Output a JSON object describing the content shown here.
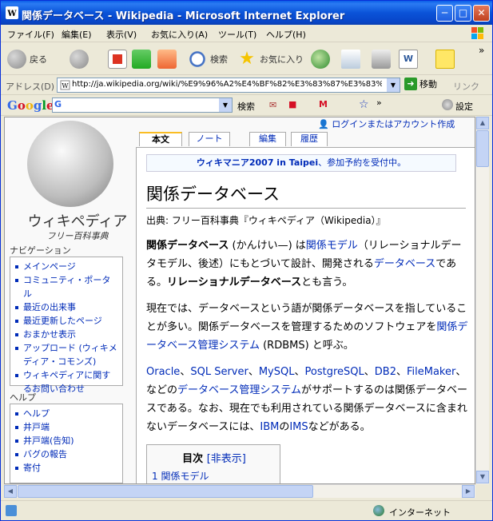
{
  "window": {
    "title": "関係データベース - Wikipedia - Microsoft Internet Explorer",
    "btn_min": "─",
    "btn_max": "□",
    "btn_close": "✕"
  },
  "menu": [
    "ファイル(F)",
    "編集(E)",
    "表示(V)",
    "お気に入り(A)",
    "ツール(T)",
    "ヘルプ(H)"
  ],
  "toolbar": {
    "back": "戻る",
    "search": "検索",
    "favorites": "お気に入り",
    "chev": "»"
  },
  "address": {
    "label": "アドレス(D)",
    "url": "http://ja.wikipedia.org/wiki/%E9%96%A2%E4%BF%82%E3%83%87%E3%83%BC%E3",
    "go": "移動",
    "links": "リンク"
  },
  "google": {
    "logo": "Google",
    "search_btn": "検索",
    "settings": "設定",
    "chev": "»"
  },
  "wiki": {
    "logo_title": "ウィキペディア",
    "logo_sub": "フリー百科事典",
    "user_link": "ログインまたはアカウント作成",
    "tabs": [
      "本文",
      "ノート",
      "編集",
      "履歴"
    ],
    "notice_link": "ウィキマニア2007 in Taipei",
    "notice_rest": "、参加予約を受付中。",
    "heading": "関係データベース",
    "from": "出典: フリー百科事典『ウィキペディア（Wikipedia）』",
    "nav_heading": "ナビゲーション",
    "nav_items": [
      "メインページ",
      "コミュニティ・ポータル",
      "最近の出来事",
      "最近更新したページ",
      "おまかせ表示",
      "アップロード (ウィキメディア・コモンズ)",
      "ウィキペディアに関するお問い合わせ"
    ],
    "help_heading": "ヘルプ",
    "help_items": [
      "ヘルプ",
      "井戸端",
      "井戸端(告知)",
      "バグの報告",
      "寄付"
    ],
    "p1": {
      "bold1": "関係データベース",
      "t1": " (かんけい—) は",
      "link1": "関係モデル",
      "t2": "（リレーショナルデータモデル、後述）にもとづいて設計、開発される",
      "link2": "データベース",
      "t3": "である。",
      "bold2": "リレーショナルデータベース",
      "t4": "とも言う。"
    },
    "p2": {
      "t1": "現在では、データベースという語が関係データベースを指していることが多い。関係データベースを管理するためのソフトウェアを",
      "link1": "関係データベース管理システム",
      "t2": " (RDBMS) と呼ぶ。"
    },
    "p3": {
      "links": [
        "Oracle",
        "SQL Server",
        "MySQL",
        "PostgreSQL",
        "DB2",
        "FileMaker"
      ],
      "sep": "、",
      "t1": "などの",
      "link1": "データベース管理システム",
      "t2": "がサポートするのは関係データベースである。なお、現在でも利用されている関係データベースに含まれないデータベースには、",
      "link2": "IBM",
      "t3": "の",
      "link3": "IMS",
      "t4": "などがある。"
    },
    "toc": {
      "title": "目次",
      "toggle": "[非表示]",
      "item1": "1 関係モデル"
    }
  },
  "status": {
    "zone": "インターネット"
  }
}
